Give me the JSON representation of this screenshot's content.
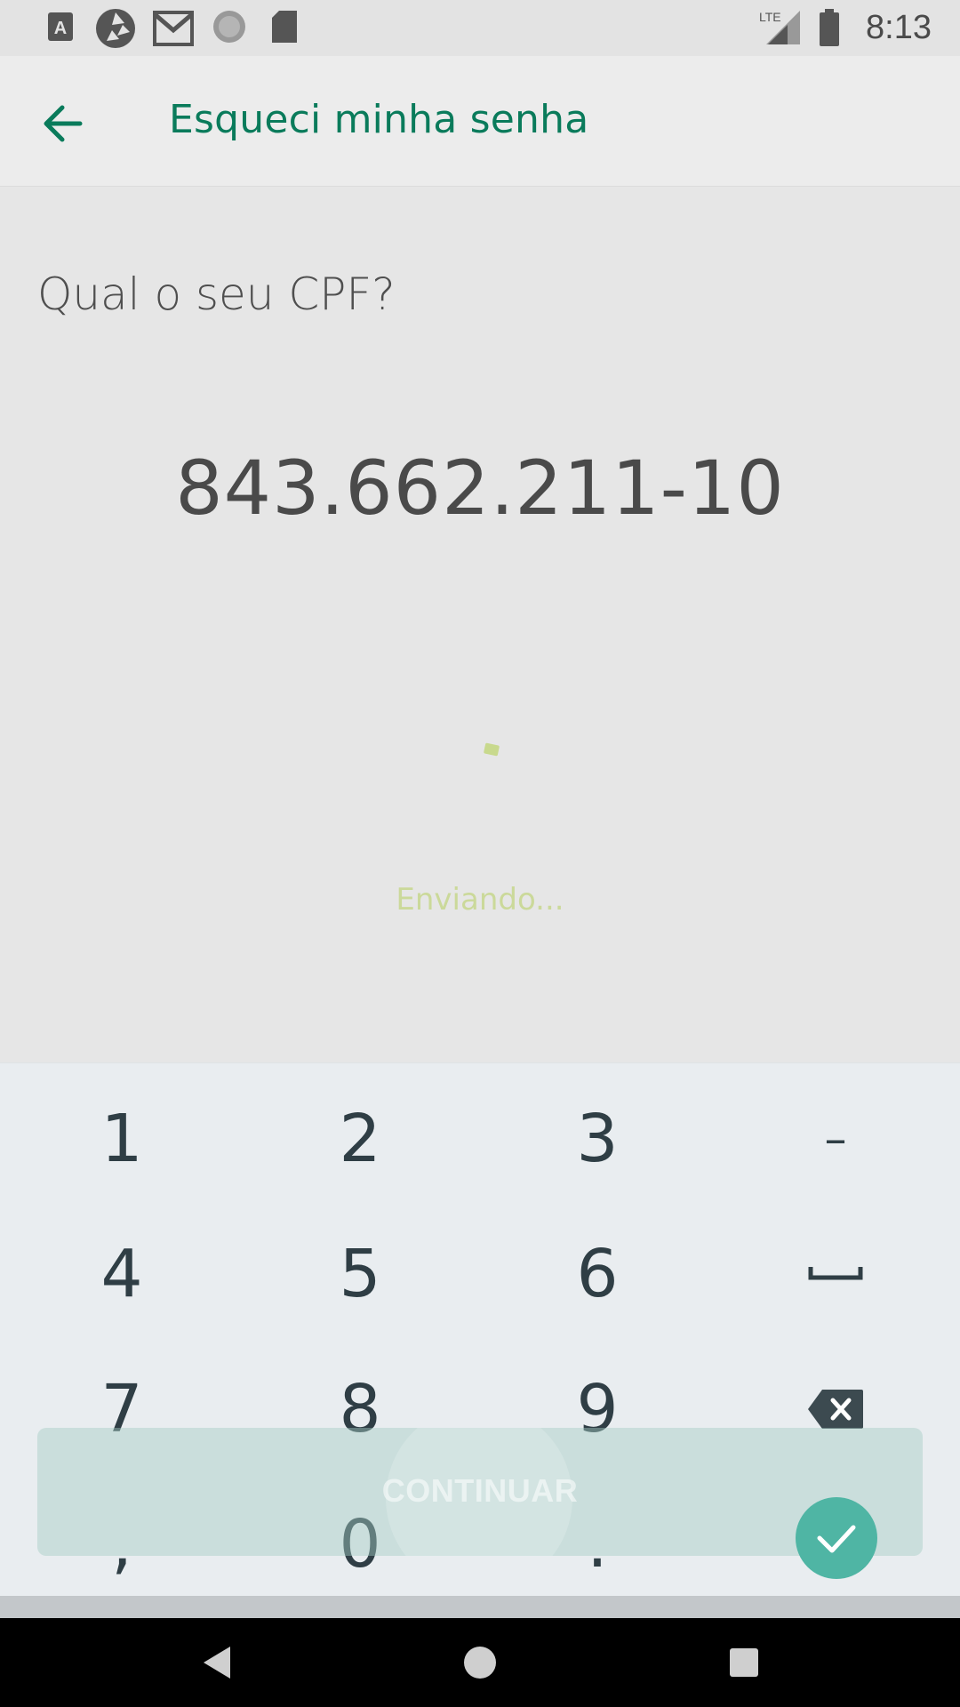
{
  "status_bar": {
    "time": "8:13",
    "network": "LTE",
    "icons": [
      "a-icon",
      "shutter-icon",
      "gmail-icon",
      "circle-icon",
      "sd-card-icon",
      "signal-icon",
      "battery-icon"
    ]
  },
  "app_bar": {
    "title": "Esqueci minha senha",
    "back_icon": "arrow-left-icon",
    "accent_color": "#0a7b5b"
  },
  "form": {
    "question": "Qual o seu CPF?",
    "cpf_value": "843.662.211-10",
    "status_text": "Enviando...",
    "continue_label": "CONTINUAR"
  },
  "keyboard": {
    "keys": [
      "1",
      "2",
      "3",
      "–",
      "4",
      "5",
      "6",
      "␣",
      "7",
      "8",
      "9",
      "⌫",
      ",",
      "0",
      ".",
      "✓"
    ]
  }
}
